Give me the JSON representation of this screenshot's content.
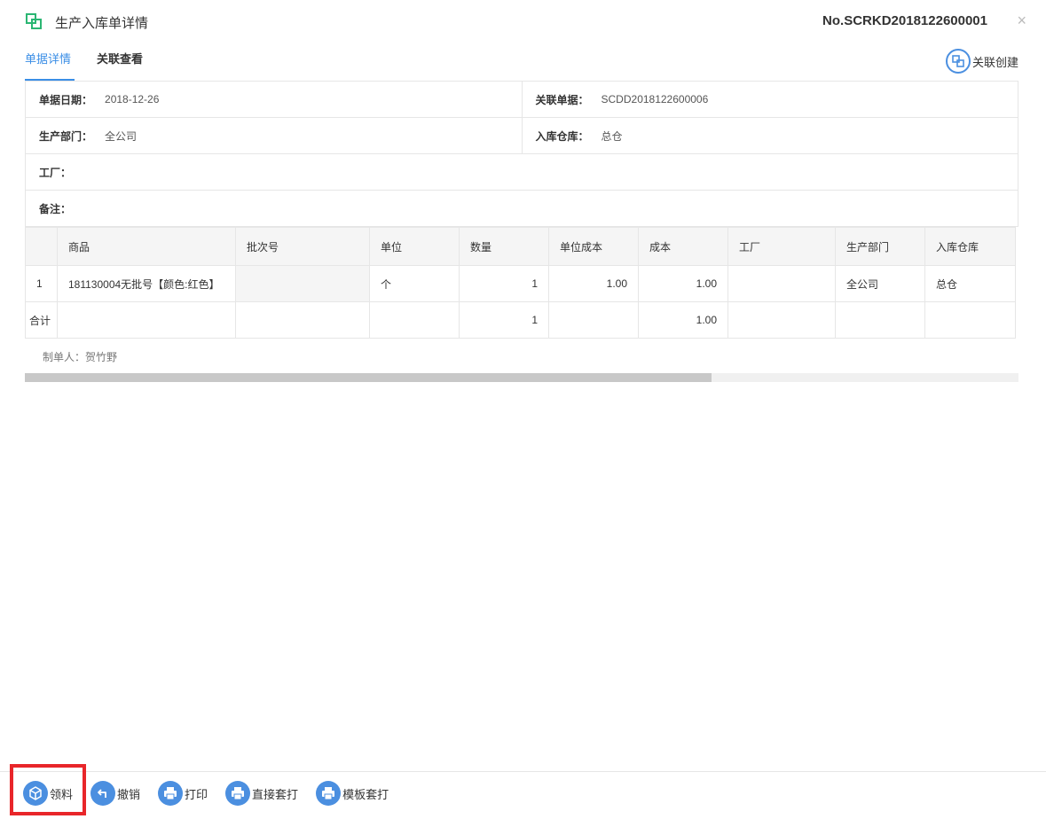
{
  "header": {
    "title": "生产入库单详情",
    "doc_no": "No.SCRKD2018122600001",
    "close_symbol": "×"
  },
  "tabs": [
    {
      "label": "单据详情",
      "active": true
    },
    {
      "label": "关联查看",
      "active": false
    }
  ],
  "link_create_label": "关联创建",
  "info": {
    "date_label": "单据日期：",
    "date_value": "2018-12-26",
    "related_label": "关联单据：",
    "related_value": "SCDD2018122600006",
    "dept_label": "生产部门：",
    "dept_value": "全公司",
    "warehouse_label": "入库仓库：",
    "warehouse_value": "总仓",
    "factory_label": "工厂：",
    "remark_label": "备注："
  },
  "table": {
    "headers": [
      "",
      "商品",
      "批次号",
      "单位",
      "数量",
      "单位成本",
      "成本",
      "工厂",
      "生产部门",
      "入库仓库"
    ],
    "rows": [
      [
        "1",
        "181130004无批号【颜色:红色】",
        "",
        "个",
        "1",
        "1.00",
        "1.00",
        "",
        "全公司",
        "总仓"
      ]
    ],
    "total_row": [
      "合计",
      "",
      "",
      "",
      "1",
      "",
      "1.00",
      "",
      "",
      ""
    ]
  },
  "maker_text": "制单人：贺竹野",
  "toolbar": {
    "items": [
      {
        "label": "领料",
        "icon": "cube-icon"
      },
      {
        "label": "撤销",
        "icon": "undo-icon"
      },
      {
        "label": "打印",
        "icon": "printer-icon"
      },
      {
        "label": "直接套打",
        "icon": "printer-icon"
      },
      {
        "label": "模板套打",
        "icon": "printer-icon"
      }
    ]
  },
  "colors": {
    "accent": "#3a8ee6",
    "icon_blue": "#4b8fe0",
    "highlight": "#e8262a",
    "logo_green": "#2bb673"
  }
}
